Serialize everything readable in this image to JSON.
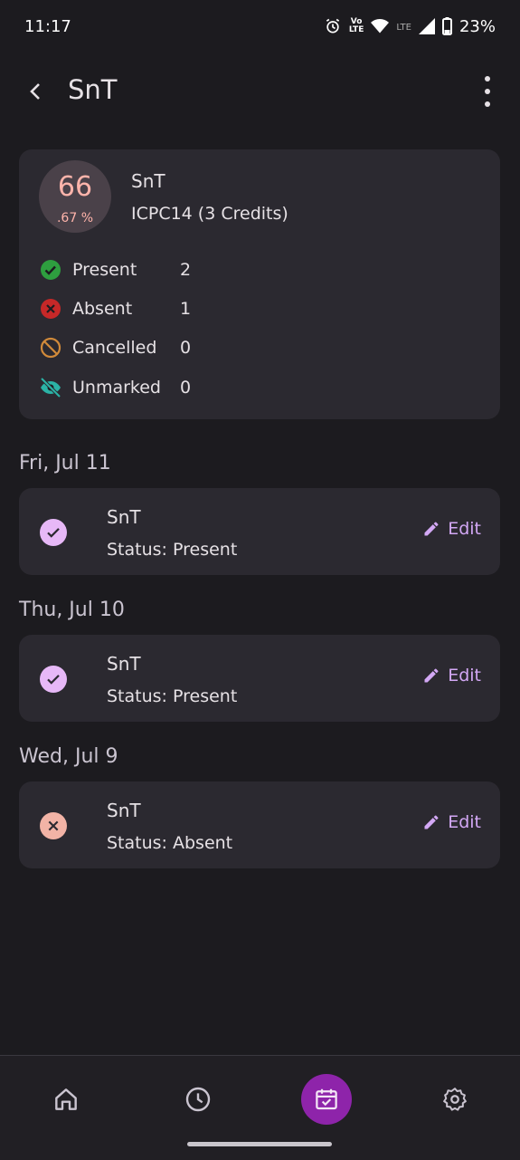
{
  "status_bar": {
    "time": "11:17",
    "battery": "23%",
    "lte": "LTE",
    "volte_top": "Vo",
    "volte_bottom": "LTE"
  },
  "header": {
    "title": "SnT"
  },
  "summary": {
    "percent_int": "66",
    "percent_dec": ".67 %",
    "name": "SnT",
    "code": "ICPC14 (3 Credits)",
    "stats": [
      {
        "label": "Present",
        "value": "2",
        "color": "#2e9e3f"
      },
      {
        "label": "Absent",
        "value": "1",
        "color": "#c62828"
      },
      {
        "label": "Cancelled",
        "value": "0",
        "color": "#d18a3a"
      },
      {
        "label": "Unmarked",
        "value": "0",
        "color": "#2bb3a6"
      }
    ]
  },
  "entries": [
    {
      "date": "Fri, Jul 11",
      "title": "SnT",
      "status": "Status: Present",
      "edit": "Edit"
    },
    {
      "date": "Thu, Jul 10",
      "title": "SnT",
      "status": "Status: Present",
      "edit": "Edit"
    },
    {
      "date": "Wed, Jul 9",
      "title": "SnT",
      "status": "Status: Absent",
      "edit": "Edit"
    }
  ],
  "colors": {
    "accent": "#8e24aa",
    "present_chip": "#e7b8f7",
    "absent_chip": "#f2b3a6",
    "edit": "#d3a8f5"
  },
  "nav": [
    "home-icon",
    "history-icon",
    "calendar-check-icon",
    "settings-icon"
  ]
}
